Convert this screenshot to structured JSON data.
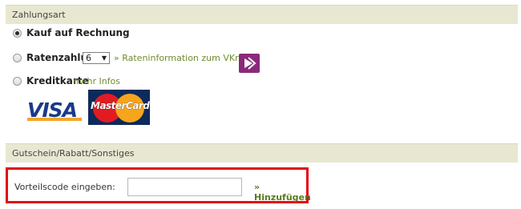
{
  "payment": {
    "header": "Zahlungsart",
    "options": [
      {
        "label": "Kauf auf Rechnung",
        "selected": true
      },
      {
        "label": "Ratenzahlung",
        "selected": false,
        "installments": "6",
        "link": "» Rateninformation zum VKrG"
      },
      {
        "label": "Kreditkarte",
        "selected": false,
        "link": "mehr Infos"
      }
    ],
    "cards": {
      "visa": "VISA",
      "mastercard": "MasterCard"
    }
  },
  "voucher": {
    "header": "Gutschein/Rabatt/Sonstiges",
    "label": "Vorteilscode eingeben:",
    "input_value": "",
    "add_link": "» Hinzufügen",
    "highlight_color": "#e30613"
  }
}
